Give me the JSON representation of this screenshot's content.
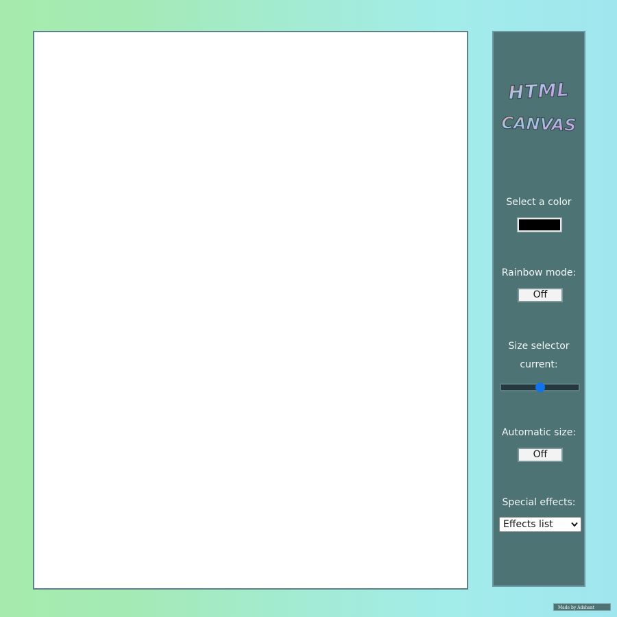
{
  "logo": {
    "line1": "HTML",
    "line2": "CANVAS",
    "colors": [
      "#e9a3ad",
      "#a3c6e6",
      "#c7a4e2",
      "#87b7cf"
    ]
  },
  "controls": {
    "color": {
      "label": "Select a color",
      "value": "#000000"
    },
    "rainbow": {
      "label": "Rainbow mode:",
      "button": "Off"
    },
    "size": {
      "label_line1": "Size selector",
      "label_line2": "current:",
      "value_fraction": 0.5
    },
    "auto_size": {
      "label": "Automatic size:",
      "button": "Off"
    },
    "effects": {
      "label": "Special effects:",
      "selected": "Effects list"
    }
  },
  "credit": "Made by Adshant",
  "colors": {
    "panel_bg": "#4e7374",
    "slider_thumb": "#1273ea",
    "canvas_bg": "#ffffff"
  }
}
